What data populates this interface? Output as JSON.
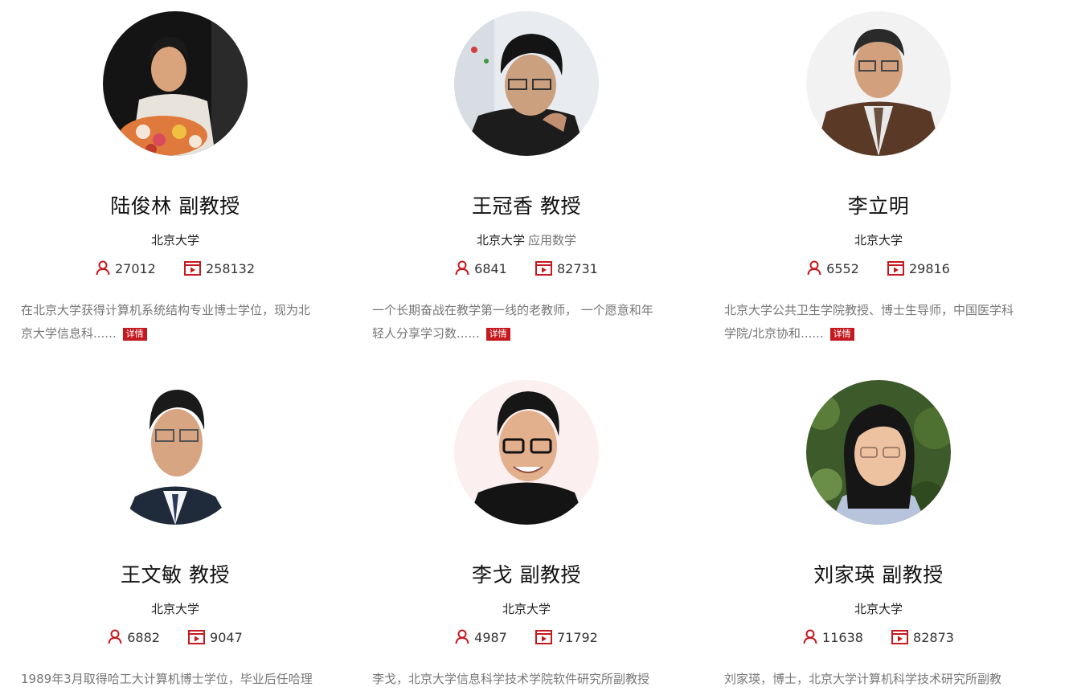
{
  "accent_color": "#c4191f",
  "teachers": [
    {
      "name": "陆俊林 副教授",
      "institution": "北京大学",
      "department": "",
      "students": "27012",
      "views": "258132",
      "description_line1": "在北京大学获得计算机系统结构专业博士学位，现为北",
      "description_line2": "京大学信息科......",
      "detail_label": "详情"
    },
    {
      "name": "王冠香 教授",
      "institution": "北京大学",
      "department": "应用数学",
      "students": "6841",
      "views": "82731",
      "description_line1": "一个长期奋战在教学第一线的老教师， 一个愿意和年",
      "description_line2": "轻人分享学习数......",
      "detail_label": "详情"
    },
    {
      "name": "李立明",
      "institution": "北京大学",
      "department": "",
      "students": "6552",
      "views": "29816",
      "description_line1": "北京大学公共卫生学院教授、博士生导师，中国医学科",
      "description_line2": "学院/北京协和......",
      "detail_label": "详情"
    },
    {
      "name": "王文敏 教授",
      "institution": "北京大学",
      "department": "",
      "students": "6882",
      "views": "9047",
      "description_line1": "1989年3月取得哈工大计算机博士学位，毕业后任哈理",
      "description_line2": "",
      "detail_label": ""
    },
    {
      "name": "李戈 副教授",
      "institution": "北京大学",
      "department": "",
      "students": "4987",
      "views": "71792",
      "description_line1": "李戈，北京大学信息科学技术学院软件研究所副教授",
      "description_line2": "",
      "detail_label": ""
    },
    {
      "name": "刘家瑛 副教授",
      "institution": "北京大学",
      "department": "",
      "students": "11638",
      "views": "82873",
      "description_line1": "刘家瑛，博士，北京大学计算机科学技术研究所副教",
      "description_line2": "",
      "detail_label": ""
    }
  ]
}
